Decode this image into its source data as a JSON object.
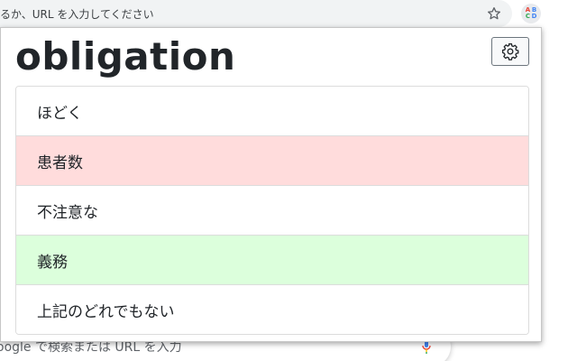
{
  "browser": {
    "omnibox_placeholder": "るか、URL を入力してください",
    "star_icon": "star-icon",
    "extension_letters": [
      "A",
      "B",
      "C",
      "D"
    ],
    "extension_colors": [
      "#ea4335",
      "#4285f4",
      "#34a853",
      "#4285f4"
    ],
    "new_tab_search_placeholder": "oogle で検索または URL を入力"
  },
  "popup": {
    "word": "obligation",
    "settings_icon": "gear-icon",
    "options": [
      {
        "label": "ほどく",
        "state": "neutral"
      },
      {
        "label": "患者数",
        "state": "wrong"
      },
      {
        "label": "不注意な",
        "state": "neutral"
      },
      {
        "label": "義務",
        "state": "correct"
      },
      {
        "label": "上記のどれでもない",
        "state": "neutral"
      }
    ],
    "colors": {
      "wrong": "#ffdcdc",
      "correct": "#dcffdc"
    }
  }
}
